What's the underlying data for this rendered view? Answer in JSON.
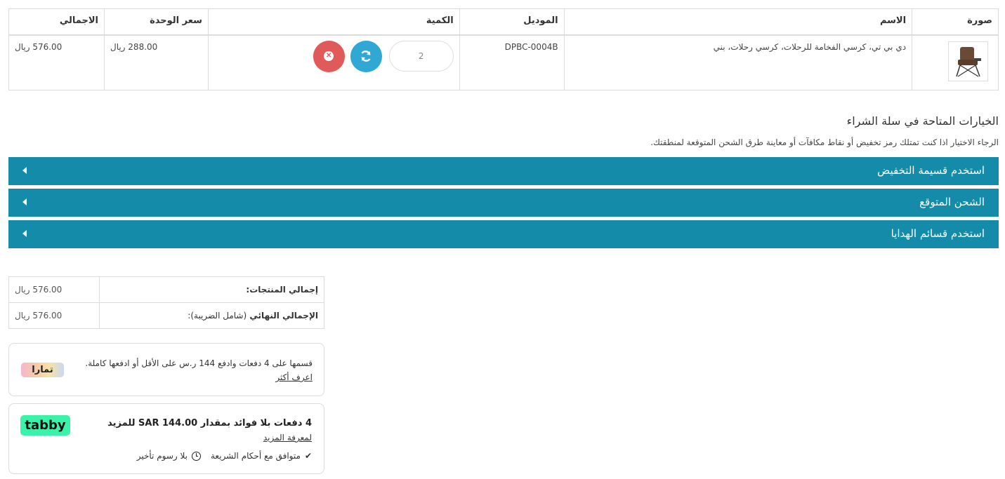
{
  "cart": {
    "headers": {
      "image": "صورة",
      "name": "الاسم",
      "model": "الموديل",
      "quantity": "الكمية",
      "unit_price": "سعر الوحدة",
      "total": "الاجمالي"
    },
    "item": {
      "name": "دي بي تي، كرسي الفخامة للرحلات، كرسي رحلات، بني",
      "model": "DPBC-0004B",
      "quantity": "2",
      "unit_price": "288.00 ريال",
      "total": "576.00 ريال"
    }
  },
  "options": {
    "title": "الخيارات المتاحة في سلة الشراء",
    "description": "الرجاء الاختيار اذا كنت تمتلك رمز تخفيض أو نقاط مكافآت أو معاينة طرق الشحن المتوقعة لمنطقتك.",
    "panels": [
      {
        "label": "استخدم قسيمة التخفيض"
      },
      {
        "label": "الشحن المتوقع"
      },
      {
        "label": "استخدم قسائم الهدايا"
      }
    ]
  },
  "totals": {
    "subtotal_label": "إجمالي المنتجات:",
    "subtotal_value": "576.00 ريال",
    "grand_label": "الإجمالي النهائي",
    "grand_label_note": "(شامل الضريبة):",
    "grand_value": "576.00 ريال"
  },
  "tamara": {
    "text": "قسمها على 4 دفعات وادفع 144 ر.س على الأقل أو ادفعها كاملة.",
    "link": "اعرف أكثر",
    "logo": "تمارا"
  },
  "tabby": {
    "headline": "4 دفعات بلا فوائد بمقدار SAR 144.00 للمزيد",
    "more_link": "لمعرفة المزيد",
    "logo": "tabby",
    "feature_sharia": "متوافق مع أحكام الشريعة",
    "feature_no_fees": "بلا رسوم تأخير"
  },
  "colors": {
    "panel": "#148ba9",
    "refresh_button": "#2fa8d3",
    "remove_button": "#e05a5a",
    "tabby_brand": "#3bf2a9"
  },
  "icons": {
    "refresh": "refresh-icon",
    "remove": "close-circle-icon",
    "caret": "caret-left-icon",
    "check": "check-icon",
    "clock": "clock-icon"
  }
}
